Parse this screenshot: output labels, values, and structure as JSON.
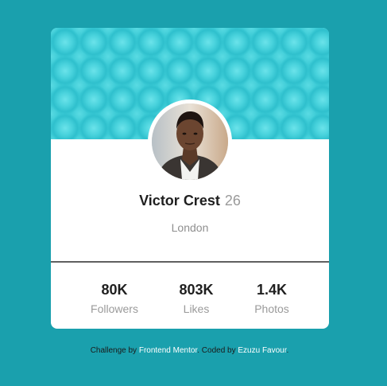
{
  "profile": {
    "name": "Victor Crest",
    "age": "26",
    "location": "London"
  },
  "stats": [
    {
      "value": "80K",
      "label": "Followers"
    },
    {
      "value": "803K",
      "label": "Likes"
    },
    {
      "value": "1.4K",
      "label": "Photos"
    }
  ],
  "attribution": {
    "challenge_prefix": "Challenge by",
    "challenge_link": "Frontend Mentor",
    "coded_prefix": "Coded by",
    "coded_link": "Ezuzu Favour"
  },
  "colors": {
    "background": "#1aa0ad",
    "banner": "#35c6d2",
    "card": "#ffffff"
  }
}
